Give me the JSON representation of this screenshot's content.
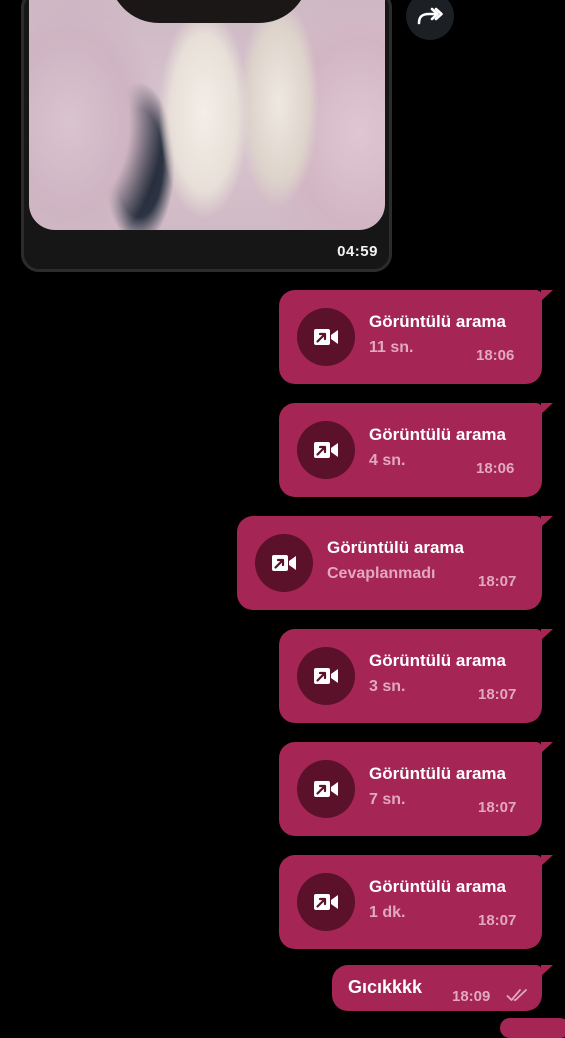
{
  "video_message": {
    "duration": "04:59"
  },
  "calls": [
    {
      "title": "Görüntülü arama",
      "detail": "11 sn.",
      "time": "18:06"
    },
    {
      "title": "Görüntülü arama",
      "detail": "4 sn.",
      "time": "18:06"
    },
    {
      "title": "Görüntülü arama",
      "detail": "Cevaplanmadı",
      "time": "18:07"
    },
    {
      "title": "Görüntülü arama",
      "detail": "3 sn.",
      "time": "18:07"
    },
    {
      "title": "Görüntülü arama",
      "detail": "7 sn.",
      "time": "18:07"
    },
    {
      "title": "Görüntülü arama",
      "detail": "1 dk.",
      "time": "18:07"
    }
  ],
  "text_message": {
    "text": "Gıcıkkkk",
    "time": "18:09",
    "status_icon": "double-check-icon"
  },
  "icons": {
    "forward": "forward-arrow-icon",
    "call": "outgoing-video-call-icon"
  },
  "colors": {
    "background": "#000000",
    "outgoing_bubble": "#a52554",
    "call_icon_circle": "#5a1129",
    "secondary_text": "#e2a9bd"
  }
}
